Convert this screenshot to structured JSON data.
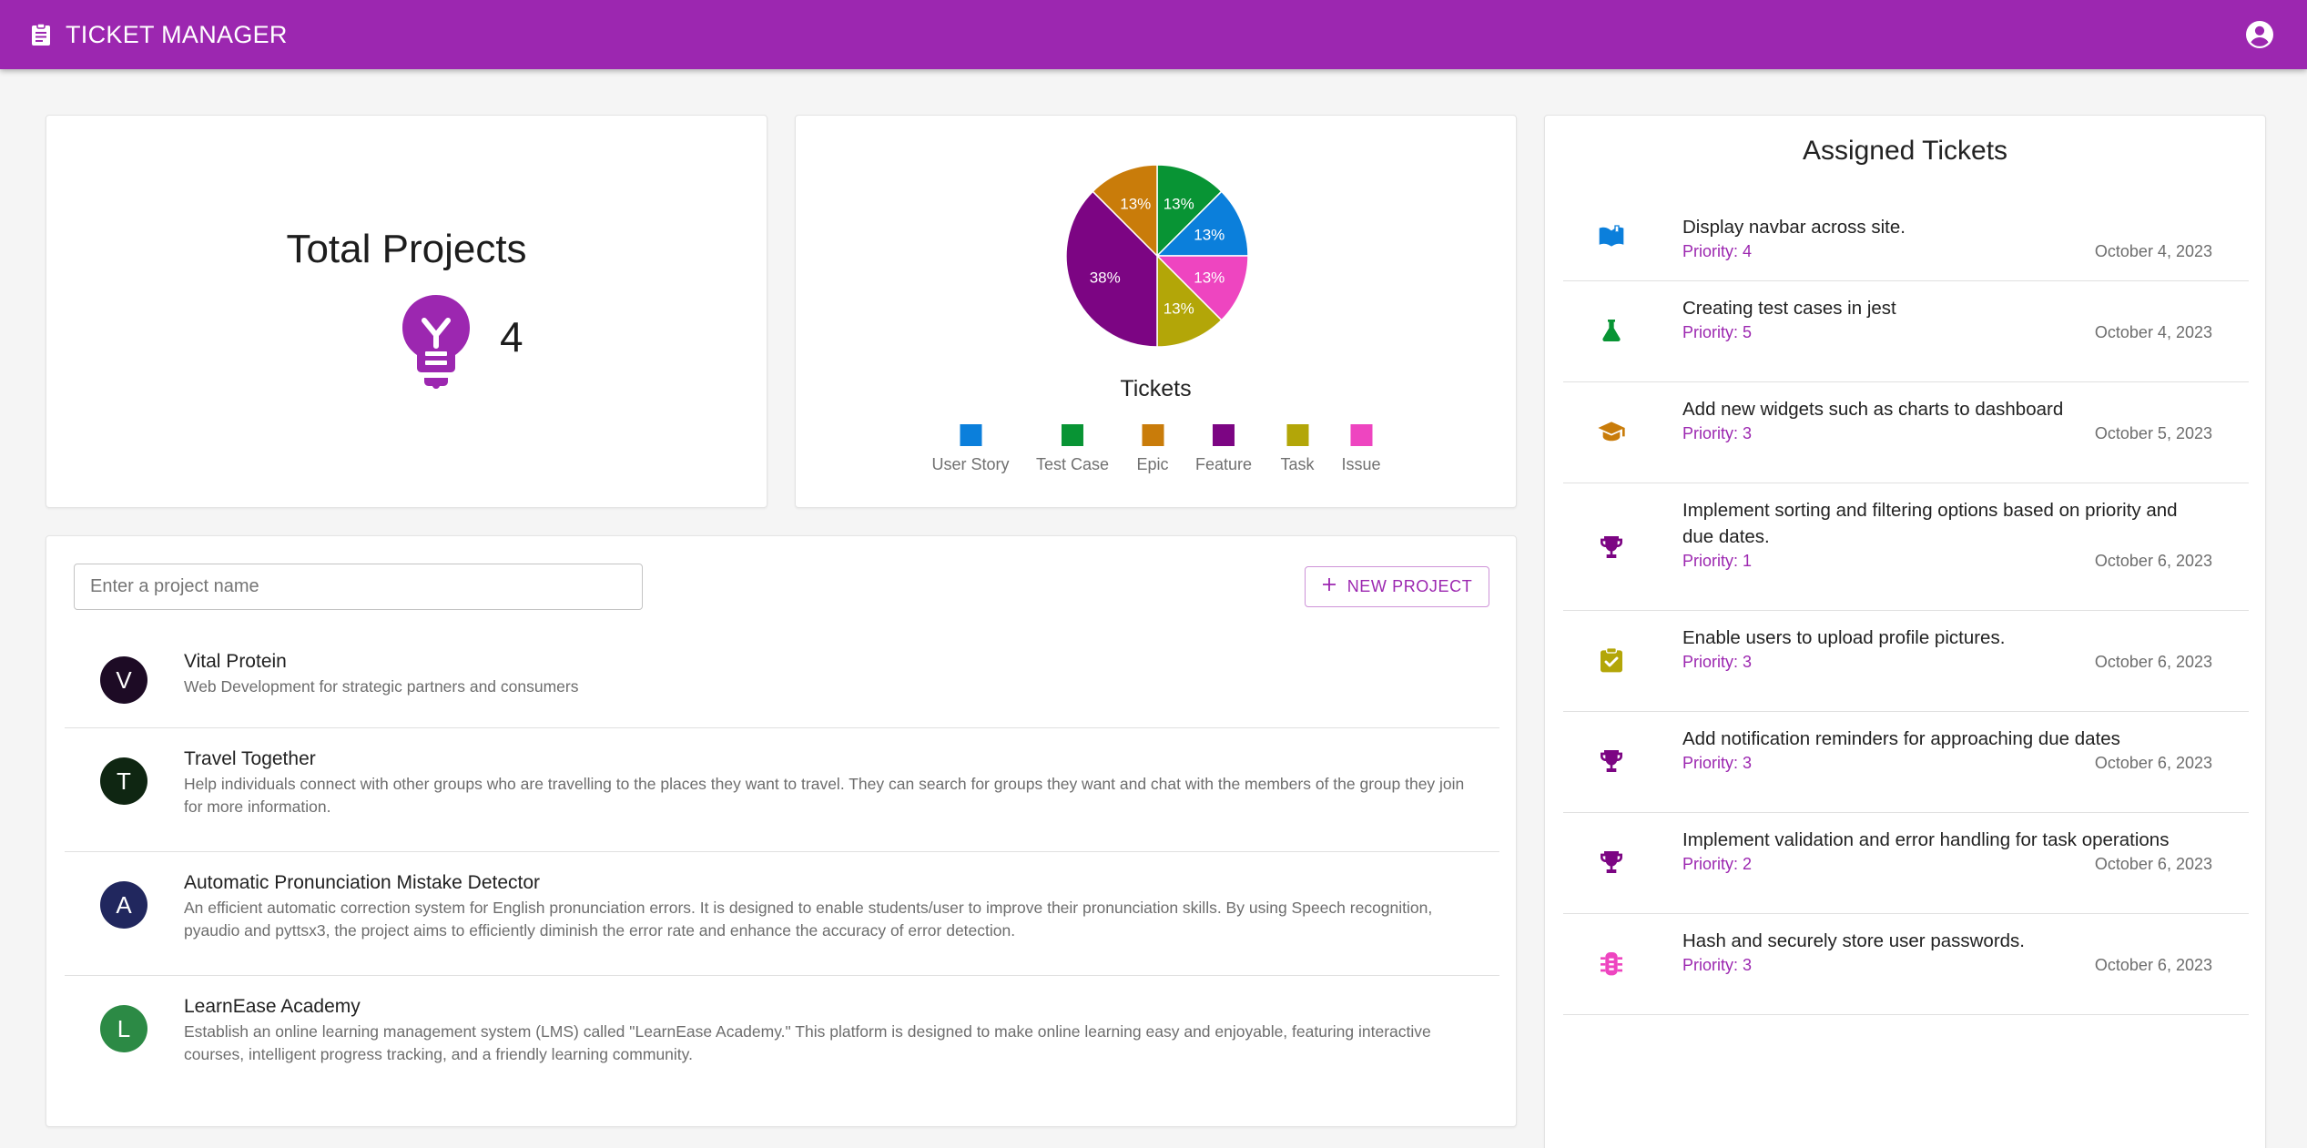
{
  "app": {
    "title": "TICKET MANAGER"
  },
  "summary": {
    "heading": "Total Projects",
    "count": "4"
  },
  "chart_data": {
    "type": "pie",
    "title": "Tickets",
    "categories": [
      "User Story",
      "Test Case",
      "Epic",
      "Feature",
      "Task",
      "Issue"
    ],
    "values": [
      1,
      1,
      1,
      3,
      1,
      1
    ],
    "labels": [
      "13%",
      "13%",
      "13%",
      "38%",
      "13%",
      "13%"
    ],
    "colors": [
      "#0b7fdb",
      "#089434",
      "#c97c0a",
      "#7c0583",
      "#b3a608",
      "#ee45c0"
    ],
    "legend_position": "bottom"
  },
  "projects": {
    "search_placeholder": "Enter a project name",
    "new_button": "NEW PROJECT",
    "items": [
      {
        "initial": "V",
        "name": "Vital Protein",
        "description": "Web Development for strategic partners and consumers",
        "color": "#1d0b25"
      },
      {
        "initial": "T",
        "name": "Travel Together",
        "description": "Help individuals connect with other groups who are travelling to the places they want to travel. They can search for groups they want and chat with the members of the group they join for more information.",
        "color": "#0f2612"
      },
      {
        "initial": "A",
        "name": "Automatic Pronunciation Mistake Detector",
        "description": "An efficient automatic correction system for English pronunciation errors. It is designed to enable students/user to improve their pronunciation skills. By using Speech recognition, pyaudio and pyttsx3, the project aims to efficiently diminish the error rate and enhance the accuracy of error detection.",
        "color": "#21275e"
      },
      {
        "initial": "L",
        "name": "LearnEase Academy",
        "description": "Establish an online learning management system (LMS) called \"LearnEase Academy.\" This platform is designed to make online learning easy and enjoyable, featuring interactive courses, intelligent progress tracking, and a friendly learning community.",
        "color": "#2c8a45"
      }
    ]
  },
  "tickets": {
    "heading": "Assigned Tickets",
    "priority_label": "Priority:",
    "items": [
      {
        "title": "Display navbar across site.",
        "priority": "4",
        "date": "October 4, 2023",
        "icon": "book-icon",
        "color": "#0b7fdb"
      },
      {
        "title": "Creating test cases in jest",
        "priority": "5",
        "date": "October 4, 2023",
        "icon": "flask-icon",
        "color": "#089434"
      },
      {
        "title": "Add new widgets such as charts to dashboard",
        "priority": "3",
        "date": "October 5, 2023",
        "icon": "graduation-cap-icon",
        "color": "#c97c0a"
      },
      {
        "title": "Implement sorting and filtering options based on priority and due dates.",
        "priority": "1",
        "date": "October 6, 2023",
        "icon": "trophy-icon",
        "color": "#7c0583"
      },
      {
        "title": "Enable users to upload profile pictures.",
        "priority": "3",
        "date": "October 6, 2023",
        "icon": "clipboard-check-icon",
        "color": "#b3a608"
      },
      {
        "title": "Add notification reminders for approaching due dates",
        "priority": "3",
        "date": "October 6, 2023",
        "icon": "trophy-icon",
        "color": "#7c0583"
      },
      {
        "title": "Implement validation and error handling for task operations",
        "priority": "2",
        "date": "October 6, 2023",
        "icon": "trophy-icon",
        "color": "#7c0583"
      },
      {
        "title": "Hash and securely store user passwords.",
        "priority": "3",
        "date": "October 6, 2023",
        "icon": "bug-icon",
        "color": "#ee45c0"
      }
    ]
  }
}
